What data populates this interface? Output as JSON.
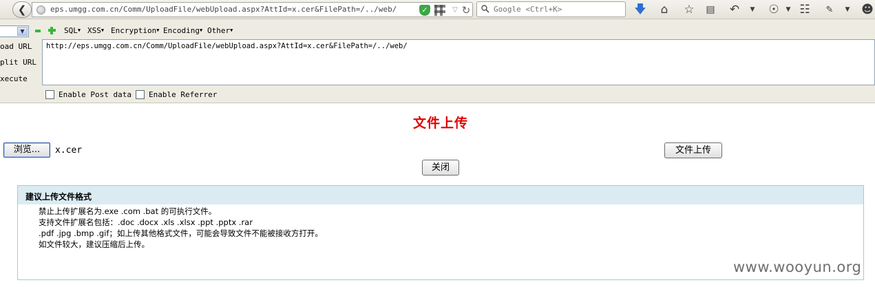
{
  "browser": {
    "url": "eps.umgg.com.cn/Comm/UploadFile/webUpload.aspx?AttId=x.cer&FilePath=/../web/",
    "search_placeholder": "Google <Ctrl+K>"
  },
  "hackbar": {
    "menus": [
      "SQL",
      "XSS",
      "Encryption",
      "Encoding",
      "Other"
    ],
    "actions": {
      "load_url": "oad URL",
      "split_url": "plit URL",
      "execute": "xecute"
    },
    "url_value": "http://eps.umgg.com.cn/Comm/UploadFile/webUpload.aspx?AttId=x.cer&FilePath=/../web/",
    "enable_post_label": "Enable Post data",
    "enable_referrer_label": "Enable Referrer"
  },
  "page": {
    "title": "文件上传",
    "browse_label": "浏览...",
    "file_name": "x.cer",
    "upload_label": "文件上传",
    "close_label": "关闭"
  },
  "tips": {
    "title": "建议上传文件格式",
    "lines": [
      "禁止上传扩展名为.exe .com .bat 的可执行文件。",
      "支持文件扩展名包括：.doc .docx .xls .xlsx .ppt .pptx .rar",
      ".pdf .jpg .bmp .gif；如上传其他格式文件，可能会导致文件不能被接收方打开。",
      "如文件较大，建议压缩后上传。"
    ]
  },
  "watermark": "www.wooyun.org",
  "colors": {
    "title_red": "#e00000",
    "tips_header_bg": "#daebf2",
    "hackbar_bg": "#eeece2"
  }
}
